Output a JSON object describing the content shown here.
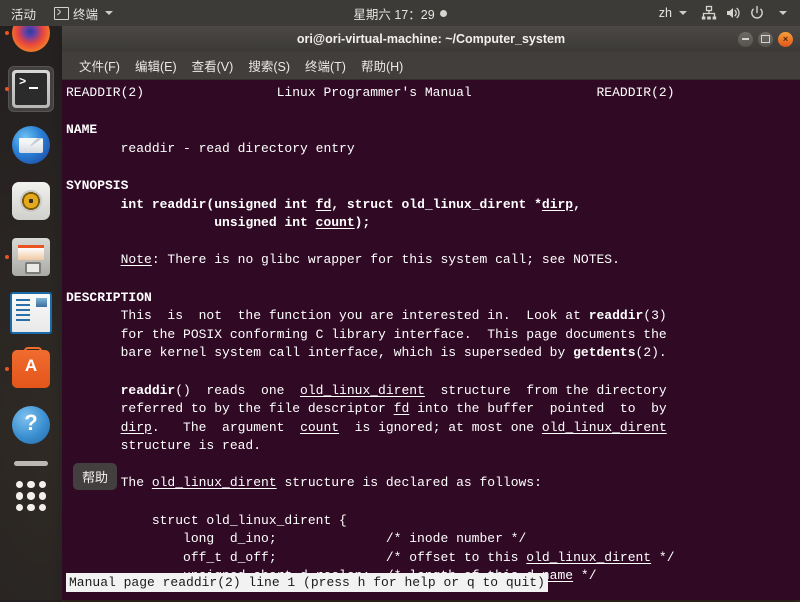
{
  "topbar": {
    "activities": "活动",
    "app_icon": "terminal-icon",
    "app_name": "终端",
    "clock": "星期六 17：29",
    "keyboard_layout": "zh",
    "icons": [
      "network-wired-icon",
      "volume-icon",
      "power-icon",
      "chevron-down-icon"
    ]
  },
  "dock": {
    "items": [
      {
        "name": "firefox",
        "label": "Firefox",
        "running": true,
        "active": false
      },
      {
        "name": "terminal",
        "label": "终端",
        "running": true,
        "active": true
      },
      {
        "name": "thunderbird",
        "label": "Thunderbird",
        "running": false,
        "active": false
      },
      {
        "name": "rhythmbox",
        "label": "Rhythmbox",
        "running": false,
        "active": false
      },
      {
        "name": "files",
        "label": "文件",
        "running": true,
        "active": false
      },
      {
        "name": "writer",
        "label": "LibreOffice Writer",
        "running": false,
        "active": false
      },
      {
        "name": "software",
        "label": "Ubuntu 软件",
        "running": true,
        "active": false
      },
      {
        "name": "help",
        "label": "帮助",
        "running": false,
        "active": false
      }
    ],
    "show_apps_label": "显示应用程序"
  },
  "tooltip": {
    "text": "帮助"
  },
  "window": {
    "title": "ori@ori-virtual-machine: ~/Computer_system",
    "buttons": {
      "minimize": "minimize",
      "maximize": "maximize",
      "close": "×"
    },
    "menus": [
      "文件(F)",
      "编辑(E)",
      "查看(V)",
      "搜索(S)",
      "终端(T)",
      "帮助(H)"
    ]
  },
  "terminal": {
    "manpage_header_left": "READDIR(2)",
    "manpage_header_center": "Linux Programmer's Manual",
    "manpage_header_right": "READDIR(2)",
    "content": "READDIR(2)                 Linux Programmer's Manual                READDIR(2)\n\n<b>NAME</b>\n       readdir - read directory entry\n\n<b>SYNOPSIS</b>\n       <b>int readdir(unsigned int </b><b><u>fd</u></b><b>, struct old_linux_dirent *</b><b><u>dirp</u></b><b>,</b>\n                   <b>unsigned int </b><b><u>count</u></b><b>);</b>\n\n       <u>Note</u>: There is no glibc wrapper for this system call; see NOTES.\n\n<b>DESCRIPTION</b>\n       This  is  not  the function you are interested in.  Look at <b>readdir</b>(3)\n       for the POSIX conforming C library interface.  This page documents the\n       bare kernel system call interface, which is superseded by <b>getdents</b>(2).\n\n       <b>readdir</b>()  reads  one  <u>old_linux_dirent</u>  structure  from the directory\n       referred to by the file descriptor <u>fd</u> into the buffer  pointed  to  by\n       <u>dirp</u>.   The  argument  <u>count</u>  is ignored; at most one <u>old_linux_dirent</u>\n       structure is read.\n\n       The <u>old_linux_dirent</u> structure is declared as follows:\n\n           struct old_linux_dirent {\n               long  d_ino;              /* inode number */\n               off_t d_off;              /* offset to this <u>old_linux_dirent</u> */\n               unsigned short d_reclen;  /* length of this <u>d_name</u> */",
    "status_line": "Manual page readdir(2) line 1 (press h for help or q to quit)",
    "colors": {
      "background": "#300a24",
      "foreground": "#ffffff",
      "status_bg": "#f2f2f2",
      "status_fg": "#1a1a1a"
    }
  }
}
